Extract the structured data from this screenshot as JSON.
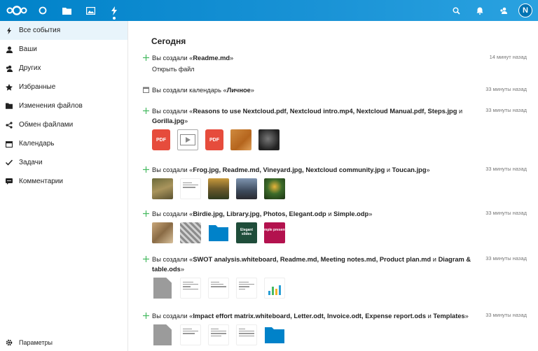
{
  "header": {
    "apps": [
      {
        "name": "dashboard",
        "icon": "circle-icon"
      },
      {
        "name": "files",
        "icon": "folder-icon"
      },
      {
        "name": "photos",
        "icon": "image-icon"
      },
      {
        "name": "activity",
        "icon": "lightning-icon"
      }
    ],
    "avatar_letter": "N"
  },
  "sidebar": {
    "items": [
      {
        "label": "Все события",
        "icon": "lightning-icon"
      },
      {
        "label": "Ваши",
        "icon": "user-icon"
      },
      {
        "label": "Других",
        "icon": "users-icon"
      },
      {
        "label": "Избранные",
        "icon": "star-icon"
      },
      {
        "label": "Изменения файлов",
        "icon": "folder-icon"
      },
      {
        "label": "Обмен файлами",
        "icon": "share-icon"
      },
      {
        "label": "Календарь",
        "icon": "calendar-icon"
      },
      {
        "label": "Задачи",
        "icon": "checkmark-icon"
      },
      {
        "label": "Комментарии",
        "icon": "comment-icon"
      }
    ],
    "settings_label": "Параметры"
  },
  "main": {
    "section_title": "Сегодня",
    "activities": [
      {
        "prefix": "Вы создали «",
        "file": "Readme.md",
        "suffix": "»",
        "time": "14 минут назад",
        "sub": "Открыть файл"
      },
      {
        "prefix": "Вы создали календарь «",
        "file": "Личное",
        "suffix": "»",
        "time": "33 минуты назад"
      },
      {
        "prefix": "Вы создали «",
        "files": "Reasons to use Nextcloud.pdf, Nextcloud intro.mp4, Nextcloud Manual.pdf, Steps.jpg",
        "and": " и ",
        "last": "Gorilla.jpg",
        "suffix": "»",
        "time": "33 минуты назад"
      },
      {
        "prefix": "Вы создали «",
        "files": "Frog.jpg, Readme.md, Vineyard.jpg, Nextcloud community.jpg",
        "and": " и ",
        "last": "Toucan.jpg",
        "suffix": "»",
        "time": "33 минуты назад"
      },
      {
        "prefix": "Вы создали «",
        "files": "Birdie.jpg, Library.jpg, Photos, Elegant.odp",
        "and": " и ",
        "last": "Simple.odp",
        "suffix": "»",
        "time": "33 минуты назад"
      },
      {
        "prefix": "Вы создали «",
        "files": "SWOT analysis.whiteboard, Readme.md, Meeting notes.md, Product plan.md",
        "and": " и ",
        "last": "Diagram & table.ods",
        "suffix": "»",
        "time": "33 минуты назад"
      },
      {
        "prefix": "Вы создали «",
        "files": "Impact effort matrix.whiteboard, Letter.odt, Invoice.odt, Expense report.ods",
        "and": " и ",
        "last": "Templates",
        "suffix": "»",
        "time": "33 минуты назад"
      }
    ],
    "thumb_labels": {
      "pdf": "PDF",
      "elegant": "Elegant slides",
      "simple": "mple presentati"
    }
  },
  "colors": {
    "accent": "#0082c9",
    "plus": "#46ba61"
  }
}
